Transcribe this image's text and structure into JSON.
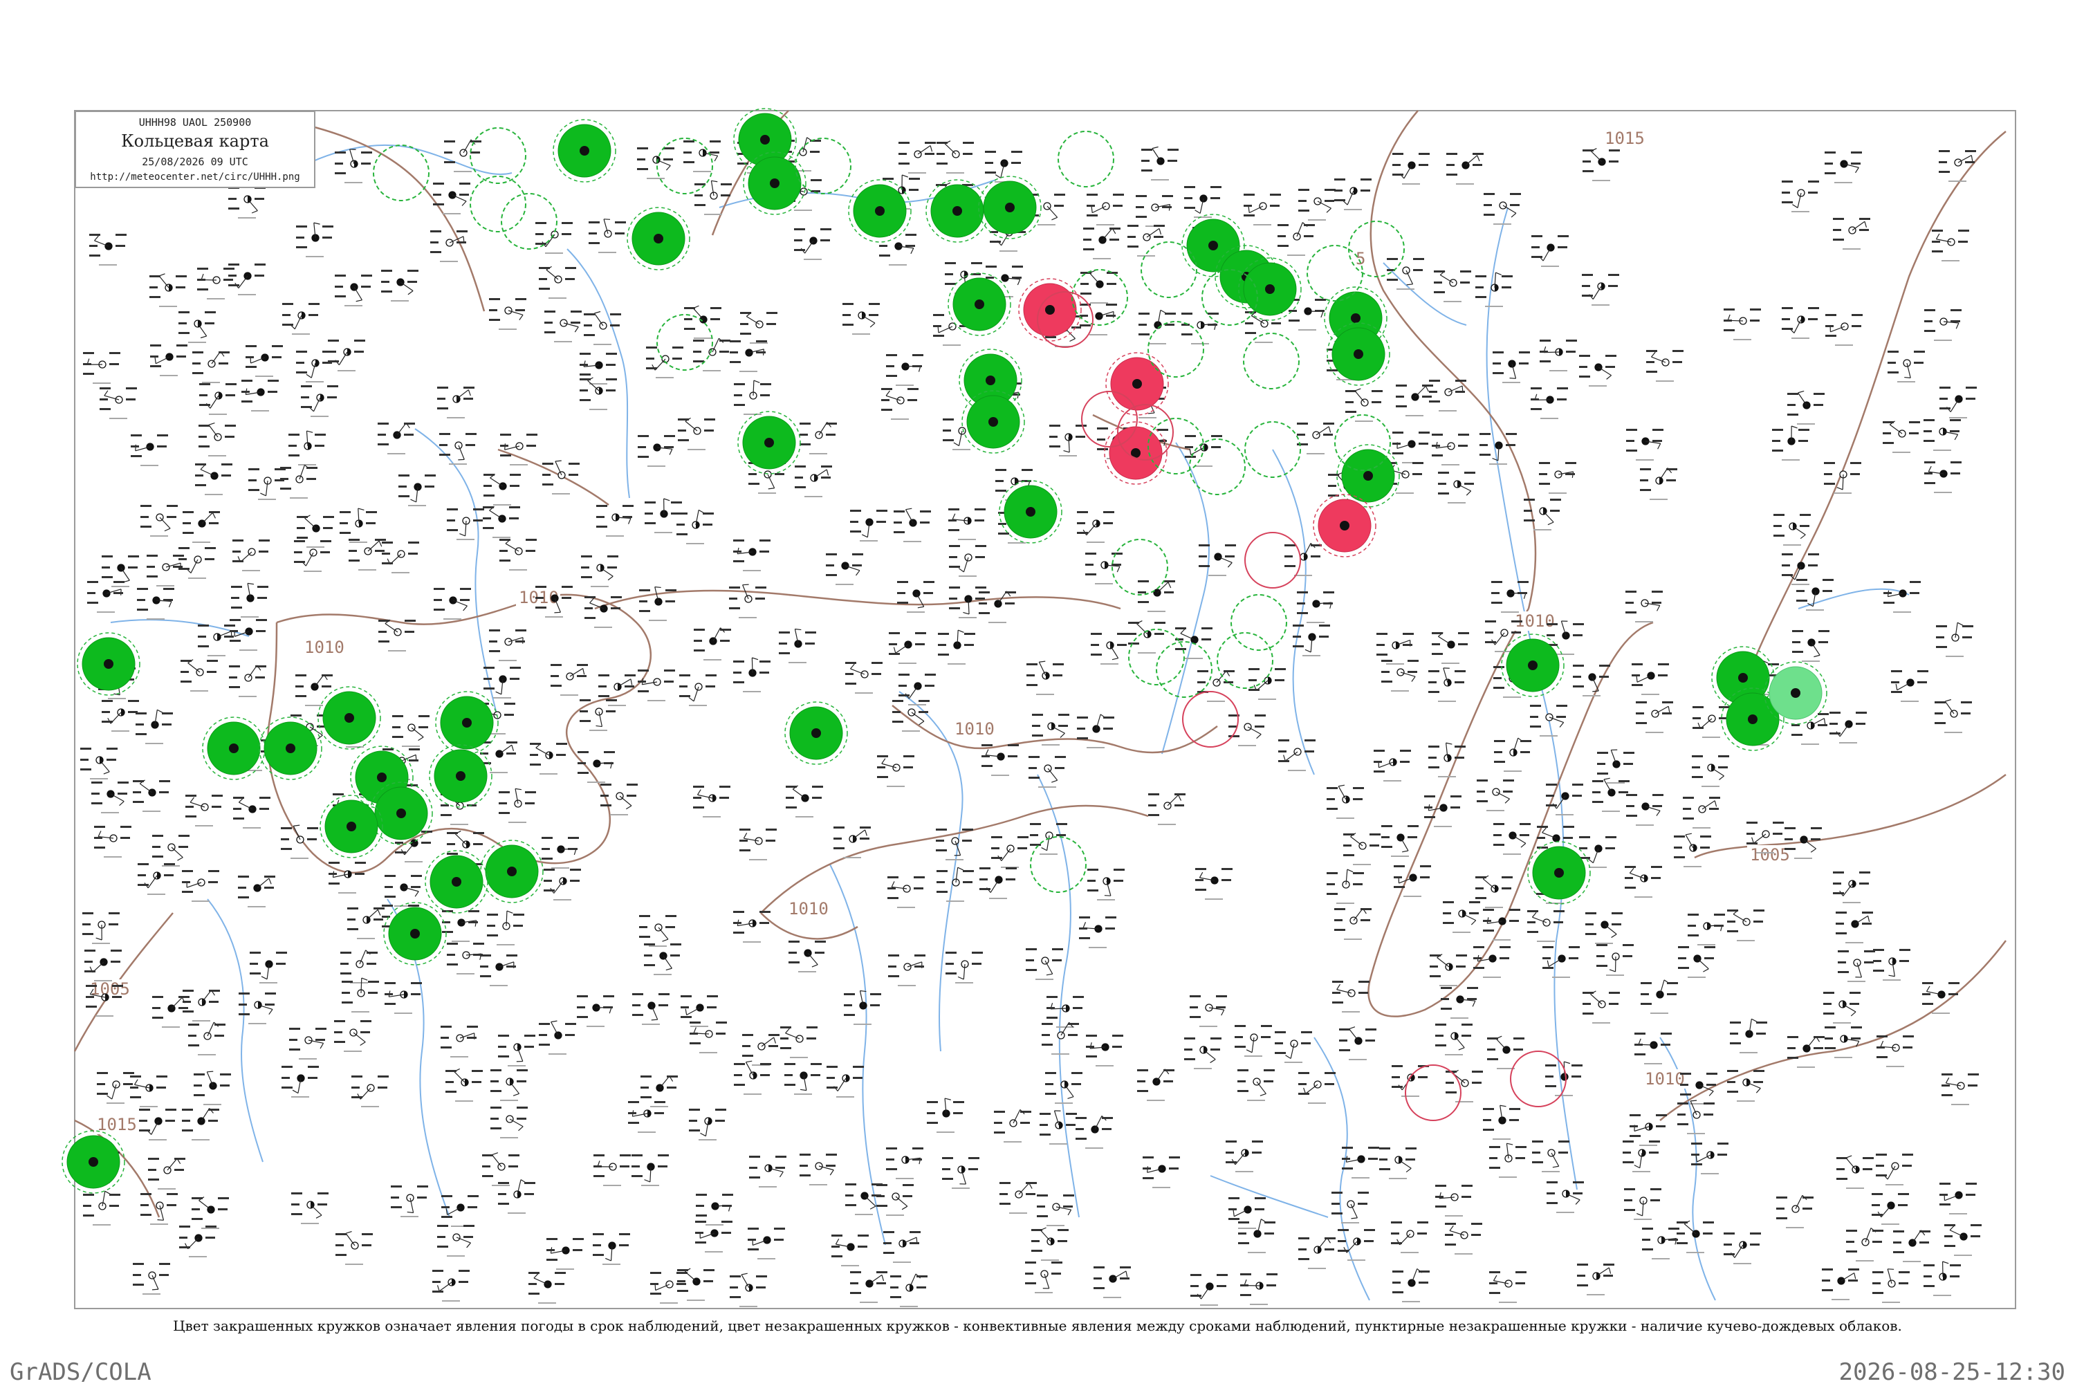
{
  "header": {
    "code_line": "UHHH98  UAOL  250900",
    "title": "Кольцевая карта",
    "date_line": "25/08/2026 09 UTC",
    "url": "http://meteocenter.net/circ/UHHH.png"
  },
  "isobars": [
    {
      "label": "1015"
    },
    {
      "label": "1010"
    },
    {
      "label": "1010"
    },
    {
      "label": "1010"
    },
    {
      "label": "1010"
    },
    {
      "label": "1010"
    },
    {
      "label": "1010"
    },
    {
      "label": "1005"
    },
    {
      "label": "1005"
    },
    {
      "label": "1015"
    },
    {
      "label": "5"
    }
  ],
  "colors": {
    "weather_green": "#0dba1e",
    "thunder_red": "#ee3a5e",
    "light_green": "#6ee08c",
    "isobar": "#a37a6a",
    "river": "#7fb3e8",
    "dashed_ring": "#28b43c",
    "red_ring": "#d6425c",
    "text": "#222222",
    "station_id": "#8a8a8a"
  },
  "legend": {
    "caption": "Цвет закрашенных кружков означает явления погоды в срок наблюдений, цвет незакрашенных кружков - конвективные явления между сроками наблюдений, пунктирные незакрашенные кружки - наличие кучево-дождевых облаков."
  },
  "footer": {
    "left": "GrADS/COLA",
    "right": "2026-08-25-12:30"
  }
}
